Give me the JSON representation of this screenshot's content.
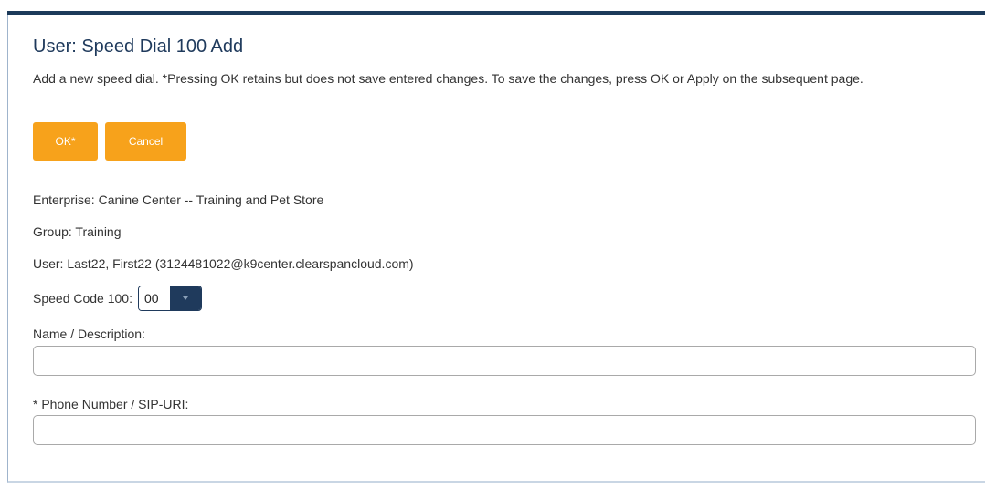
{
  "page": {
    "title": "User: Speed Dial 100 Add",
    "description": "Add a new speed dial. *Pressing OK retains but does not save entered changes. To save the changes, press OK or Apply on the subsequent page."
  },
  "buttons": {
    "ok_label": "OK*",
    "cancel_label": "Cancel"
  },
  "info": {
    "enterprise": "Enterprise:  Canine Center -- Training and Pet Store",
    "group": "Group:  Training",
    "user": "User:  Last22, First22 (3124481022@k9center.clearspancloud.com)"
  },
  "speed_code": {
    "label": "Speed Code 100:",
    "selected": "00"
  },
  "fields": {
    "name_label": "Name / Description:",
    "name_value": "",
    "phone_label": "* Phone Number / SIP-URI:",
    "phone_value": ""
  },
  "colors": {
    "accent": "#f7a21b",
    "header_bar": "#1c3a5a",
    "title": "#1f3a5c"
  }
}
